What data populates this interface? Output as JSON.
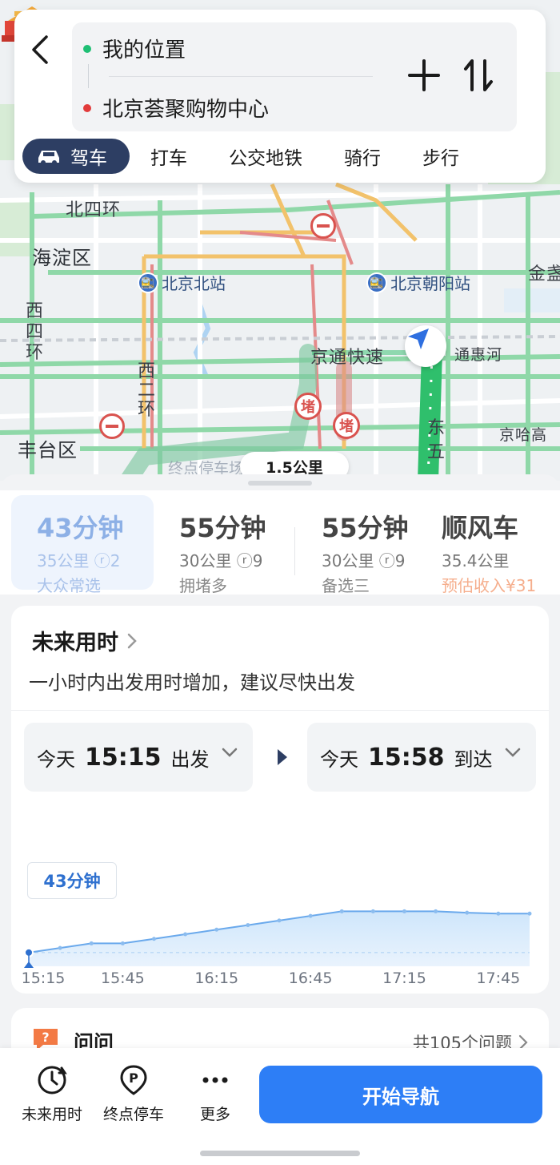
{
  "search": {
    "from": "我的位置",
    "to": "北京荟聚购物中心"
  },
  "modes": [
    {
      "label": "驾车"
    },
    {
      "label": "打车"
    },
    {
      "label": "公交地铁"
    },
    {
      "label": "骑行"
    },
    {
      "label": "步行"
    }
  ],
  "map": {
    "labels": {
      "beisihuan": "北四环",
      "haidian": "海淀区",
      "xisihuan": "西四环",
      "xierhuan": "西二环",
      "fengtai": "丰台区",
      "jingtong": "京通快速",
      "tonghuihe": "通惠河",
      "dongwu": "东五",
      "jinghagao": "京哈高",
      "jinzhan": "金盏"
    },
    "stations": {
      "beijingbei": "北京北站",
      "beijingchaoyang": "北京朝阳站"
    },
    "jam_label": "堵",
    "hint": "终点停车场 ",
    "distance": "1.5公里"
  },
  "routes": [
    {
      "time": "43分钟",
      "meta": "35公里  ⓡ2",
      "tag": "大众常选"
    },
    {
      "time": "55分钟",
      "meta": "30公里  ⓡ9",
      "tag": "拥堵多"
    },
    {
      "time": "55分钟",
      "meta": "30公里  ⓡ9",
      "tag": "备选三"
    },
    {
      "time": "顺风车",
      "meta": "35.4公里",
      "tag": "预估收入¥31"
    }
  ],
  "future": {
    "title": "未来用时",
    "subtitle": "一小时内出发用时增加，建议尽快出发",
    "depart": {
      "day": "今天",
      "time": "15:15",
      "label": "出发"
    },
    "arrive": {
      "day": "今天",
      "time": "15:58",
      "label": "到达"
    },
    "badge": "43分钟"
  },
  "chart_data": {
    "type": "area",
    "x": [
      "15:15",
      "15:25",
      "15:35",
      "15:45",
      "15:55",
      "16:05",
      "16:15",
      "16:25",
      "16:35",
      "16:45",
      "16:55",
      "17:05",
      "17:15",
      "17:25",
      "17:35",
      "17:45",
      "17:55"
    ],
    "tick_labels": [
      "15:15",
      "15:45",
      "16:15",
      "16:45",
      "17:15",
      "17:45"
    ],
    "values": [
      43,
      44,
      45,
      45,
      46,
      47,
      48,
      49,
      50,
      51,
      52,
      52,
      52,
      52,
      51.7,
      51.5,
      51.5
    ],
    "ylim": [
      40,
      54
    ],
    "grid": false,
    "color": "#6aa9ec"
  },
  "qa": {
    "title": "问问",
    "count": "共105个问题"
  },
  "bottom": {
    "future_time": "未来用时",
    "parking": "终点停车",
    "more": "更多",
    "start_nav": "开始导航"
  },
  "colors": {
    "accent": "#2d7ef6",
    "active_tab": "#2d3e63",
    "from_dot": "#1fbf74",
    "to_dot": "#e23b3b",
    "route_green": "#2fbf6c",
    "jam_red": "#d9534f"
  },
  "icons": {
    "back": "chevron-left-icon",
    "plus": "plus-icon",
    "swap": "swap-vertical-icon",
    "car": "car-icon",
    "clock": "clock-icon",
    "parking": "parking-icon",
    "more": "more-dots-icon",
    "qa": "question-bubble-icon"
  }
}
